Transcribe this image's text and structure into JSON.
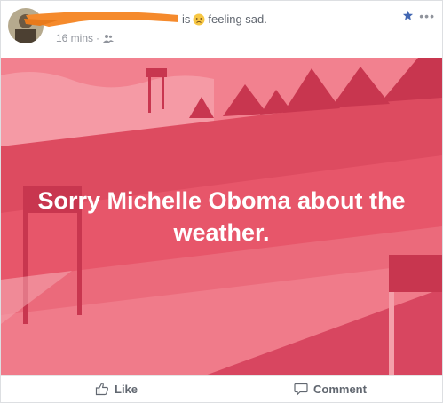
{
  "post": {
    "status_is": "is",
    "status_feeling": "feeling sad.",
    "emoji": "sad-face-emoji",
    "time": "16 mins",
    "separator": "·",
    "audience_icon": "friends-icon"
  },
  "banner": {
    "text": "Sorry Michelle Oboma about the weather.",
    "colors": {
      "base": "#e7566a",
      "light": "#f07b8a",
      "lighter": "#f59aa5",
      "dark": "#c8364f"
    }
  },
  "footer": {
    "like_label": "Like",
    "comment_label": "Comment"
  },
  "colors": {
    "redaction": "#f58a2c",
    "star": "#4267b2",
    "meta_text": "#90949c",
    "action_text": "#616770"
  }
}
